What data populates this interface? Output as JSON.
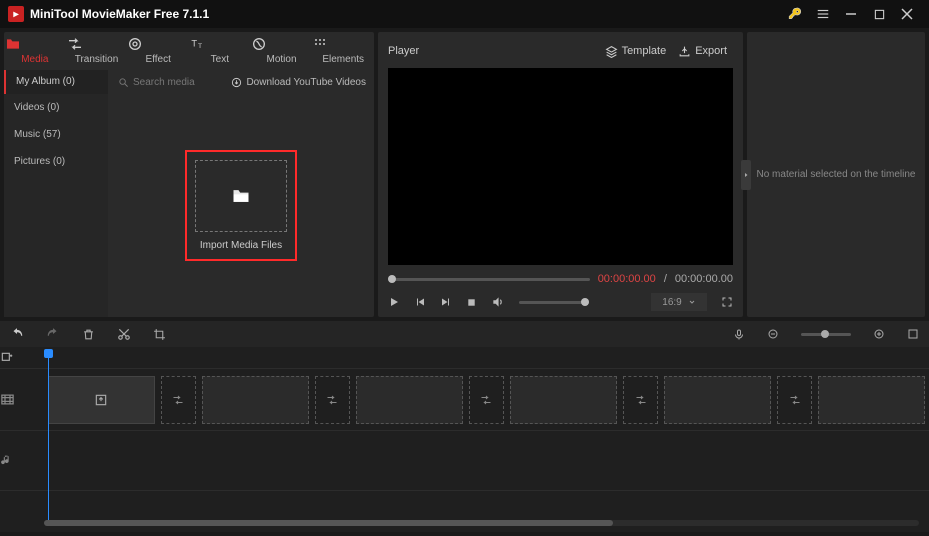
{
  "app": {
    "title": "MiniTool MovieMaker Free 7.1.1"
  },
  "tabs": {
    "media": "Media",
    "transition": "Transition",
    "effect": "Effect",
    "text": "Text",
    "motion": "Motion",
    "elements": "Elements"
  },
  "subbar": {
    "album": "My Album (0)",
    "search_placeholder": "Search media",
    "download": "Download YouTube Videos"
  },
  "sidelist": {
    "videos": "Videos (0)",
    "music": "Music (57)",
    "pictures": "Pictures (0)"
  },
  "import_label": "Import Media Files",
  "player": {
    "title": "Player",
    "template": "Template",
    "export": "Export",
    "time_current": "00:00:00.00",
    "time_sep": " / ",
    "time_duration": "00:00:00.00",
    "ratio": "16:9"
  },
  "side_panel": {
    "message": "No material selected on the timeline"
  }
}
